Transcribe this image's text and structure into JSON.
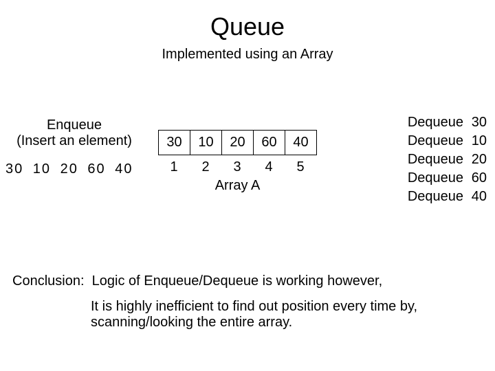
{
  "title": "Queue",
  "subtitle": "Implemented using an Array",
  "enqueue": {
    "title": "Enqueue",
    "subtitle": "(Insert an element)",
    "values_text": "30  10  20  60  40"
  },
  "array": {
    "cells": [
      "30",
      "10",
      "20",
      "60",
      "40"
    ],
    "indices": [
      "1",
      "2",
      "3",
      "4",
      "5"
    ],
    "label": "Array A"
  },
  "dequeue": {
    "label": "Dequeue",
    "rows": [
      "30",
      "10",
      "20",
      "60",
      "40"
    ]
  },
  "conclusion": {
    "label": "Conclusion:",
    "line1": "Logic of Enqueue/Dequeue is working however,",
    "line2": "It is highly inefficient to find out position every time by, scanning/looking the entire array."
  }
}
